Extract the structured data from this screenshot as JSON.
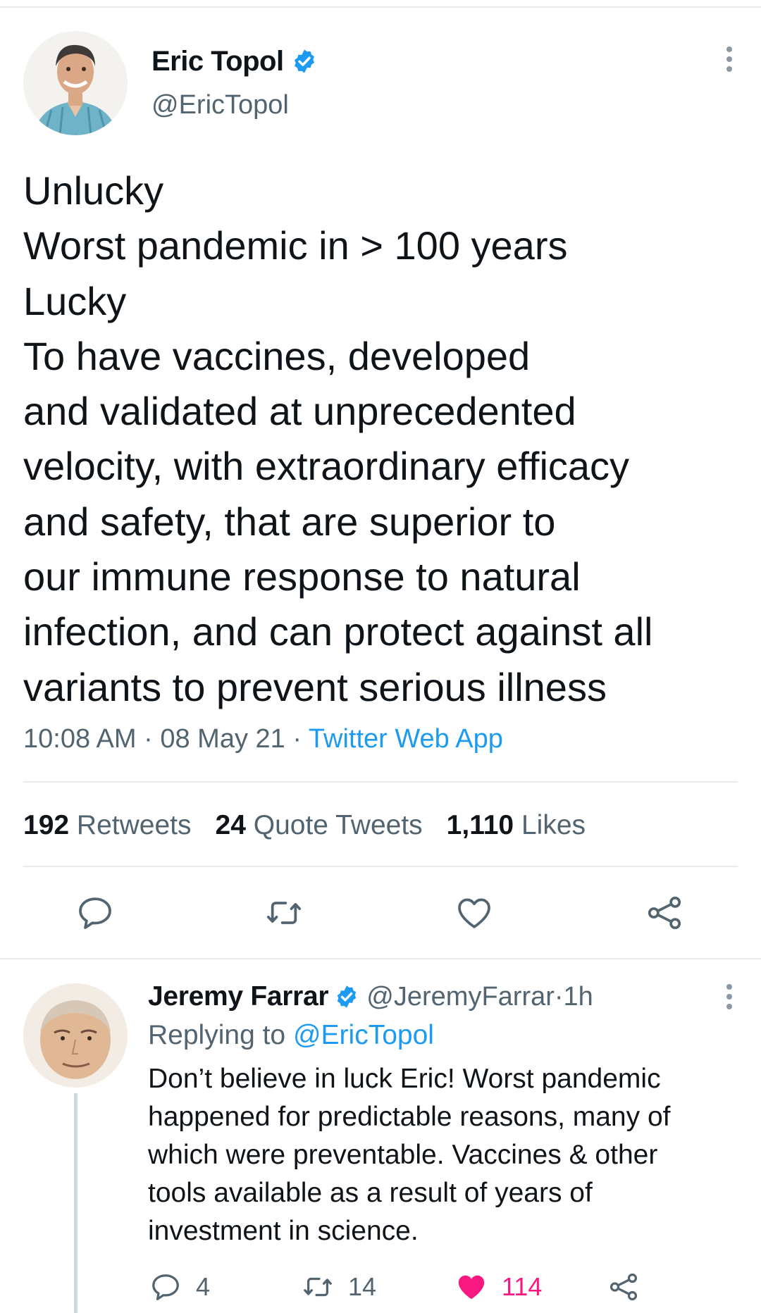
{
  "tweet": {
    "author_name": "Eric Topol",
    "author_handle": "@EricTopol",
    "text_lines": [
      "Unlucky",
      "Worst pandemic in > 100 years",
      "Lucky",
      "To have vaccines, developed",
      "and validated at unprecedented",
      "velocity, with extraordinary efficacy",
      "and safety, that are superior to",
      "our immune response to natural",
      "infection, and can protect against all",
      "variants to prevent serious illness"
    ],
    "time": "10:08 AM",
    "date": "08 May 21",
    "source": "Twitter Web App",
    "separator": " · ",
    "stats": {
      "retweets_count": "192",
      "retweets_label": "Retweets",
      "quotes_count": "24",
      "quotes_label": "Quote Tweets",
      "likes_count": "1,110",
      "likes_label": "Likes"
    },
    "actions": [
      "reply-icon",
      "retweet-icon",
      "like-icon",
      "share-icon"
    ]
  },
  "reply": {
    "author_name": "Jeremy Farrar",
    "author_handle": "@JeremyFarrar",
    "age": "1h",
    "meta_separator": " · ",
    "replying_prefix": "Replying to ",
    "replying_to": "@EricTopol",
    "text_lines": [
      "Don’t believe in luck Eric! Worst pandemic",
      "happened for predictable reasons, many of",
      "which were preventable. Vaccines & other",
      "tools available as a result of years of",
      "investment in science."
    ],
    "reply_count": "4",
    "retweet_count": "14",
    "like_count": "114",
    "liked": true
  },
  "colors": {
    "text": "#0f1419",
    "secondary": "#536471",
    "link": "#1d9bf0",
    "verified": "#1d9bf0",
    "like_active": "#f91880",
    "divider": "#e6ecf0"
  }
}
